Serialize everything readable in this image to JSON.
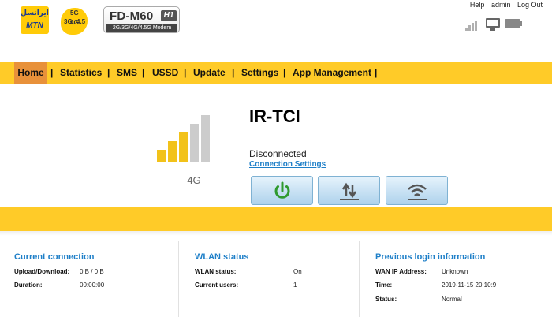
{
  "brand": {
    "operator_fa": "ایرانسل",
    "operator_en": "MTN",
    "badge": [
      "5G",
      "3G",
      "4G",
      "4.5"
    ],
    "model": "FD-M60",
    "model_suffix": "H1",
    "model_subtitle": "2G/3G/4G/4.5G Modem"
  },
  "top_links": [
    "Help",
    "admin",
    "Log Out"
  ],
  "status_icons": [
    "signal-strength-icon",
    "monitor-icon",
    "battery-icon"
  ],
  "nav": {
    "items": [
      "Home",
      "Statistics",
      "SMS",
      "USSD",
      "Update",
      "Settings",
      "App Management"
    ],
    "separator": "|",
    "active": "Home"
  },
  "colors": {
    "accent_yellow": "#ffcb28",
    "nav_active": "#e8913a",
    "link_blue": "#1e7fc8",
    "signal_active": "#f2c21a",
    "signal_inactive": "#cccccc"
  },
  "signal": {
    "network_type": "4G",
    "bars_total": 5,
    "bars_active": 3
  },
  "connection": {
    "ssid": "IR-TCI",
    "status": "Disconnected",
    "settings_link": "Connection Settings",
    "buttons": [
      "power-icon",
      "data-transfer-icon",
      "wifi-icon"
    ]
  },
  "panels": {
    "current": {
      "title": "Current connection",
      "rows": [
        {
          "label": "Upload/Download:",
          "value": "0 B / 0 B"
        },
        {
          "label": "Duration:",
          "value": "00:00:00"
        }
      ]
    },
    "wlan": {
      "title": "WLAN status",
      "rows": [
        {
          "label": "WLAN status:",
          "value": "On"
        },
        {
          "label": "Current users:",
          "value": "1"
        }
      ]
    },
    "login": {
      "title": "Previous login information",
      "rows": [
        {
          "label": "WAN IP Address:",
          "value": "Unknown"
        },
        {
          "label": "Time:",
          "value": "2019-11-15 20:10:9"
        },
        {
          "label": "Status:",
          "value": "Normal"
        }
      ]
    }
  }
}
